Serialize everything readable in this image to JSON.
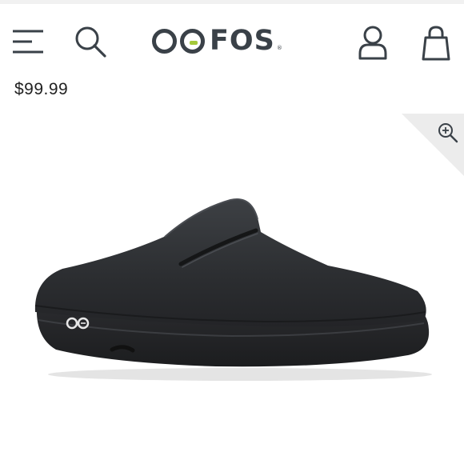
{
  "header": {
    "brand": "OOFOS",
    "icons": {
      "menu": "hamburger-menu-icon",
      "search": "search-icon",
      "account": "user-icon",
      "cart": "shopping-bag-icon"
    }
  },
  "product": {
    "price": "$99.99",
    "image_icon": "clog-shoe",
    "zoom_icon": "zoom-in-icon",
    "colors": {
      "shoe": "#2b2d30",
      "logo_dark": "#3a4148",
      "logo_accent": "#a4c93a"
    }
  }
}
